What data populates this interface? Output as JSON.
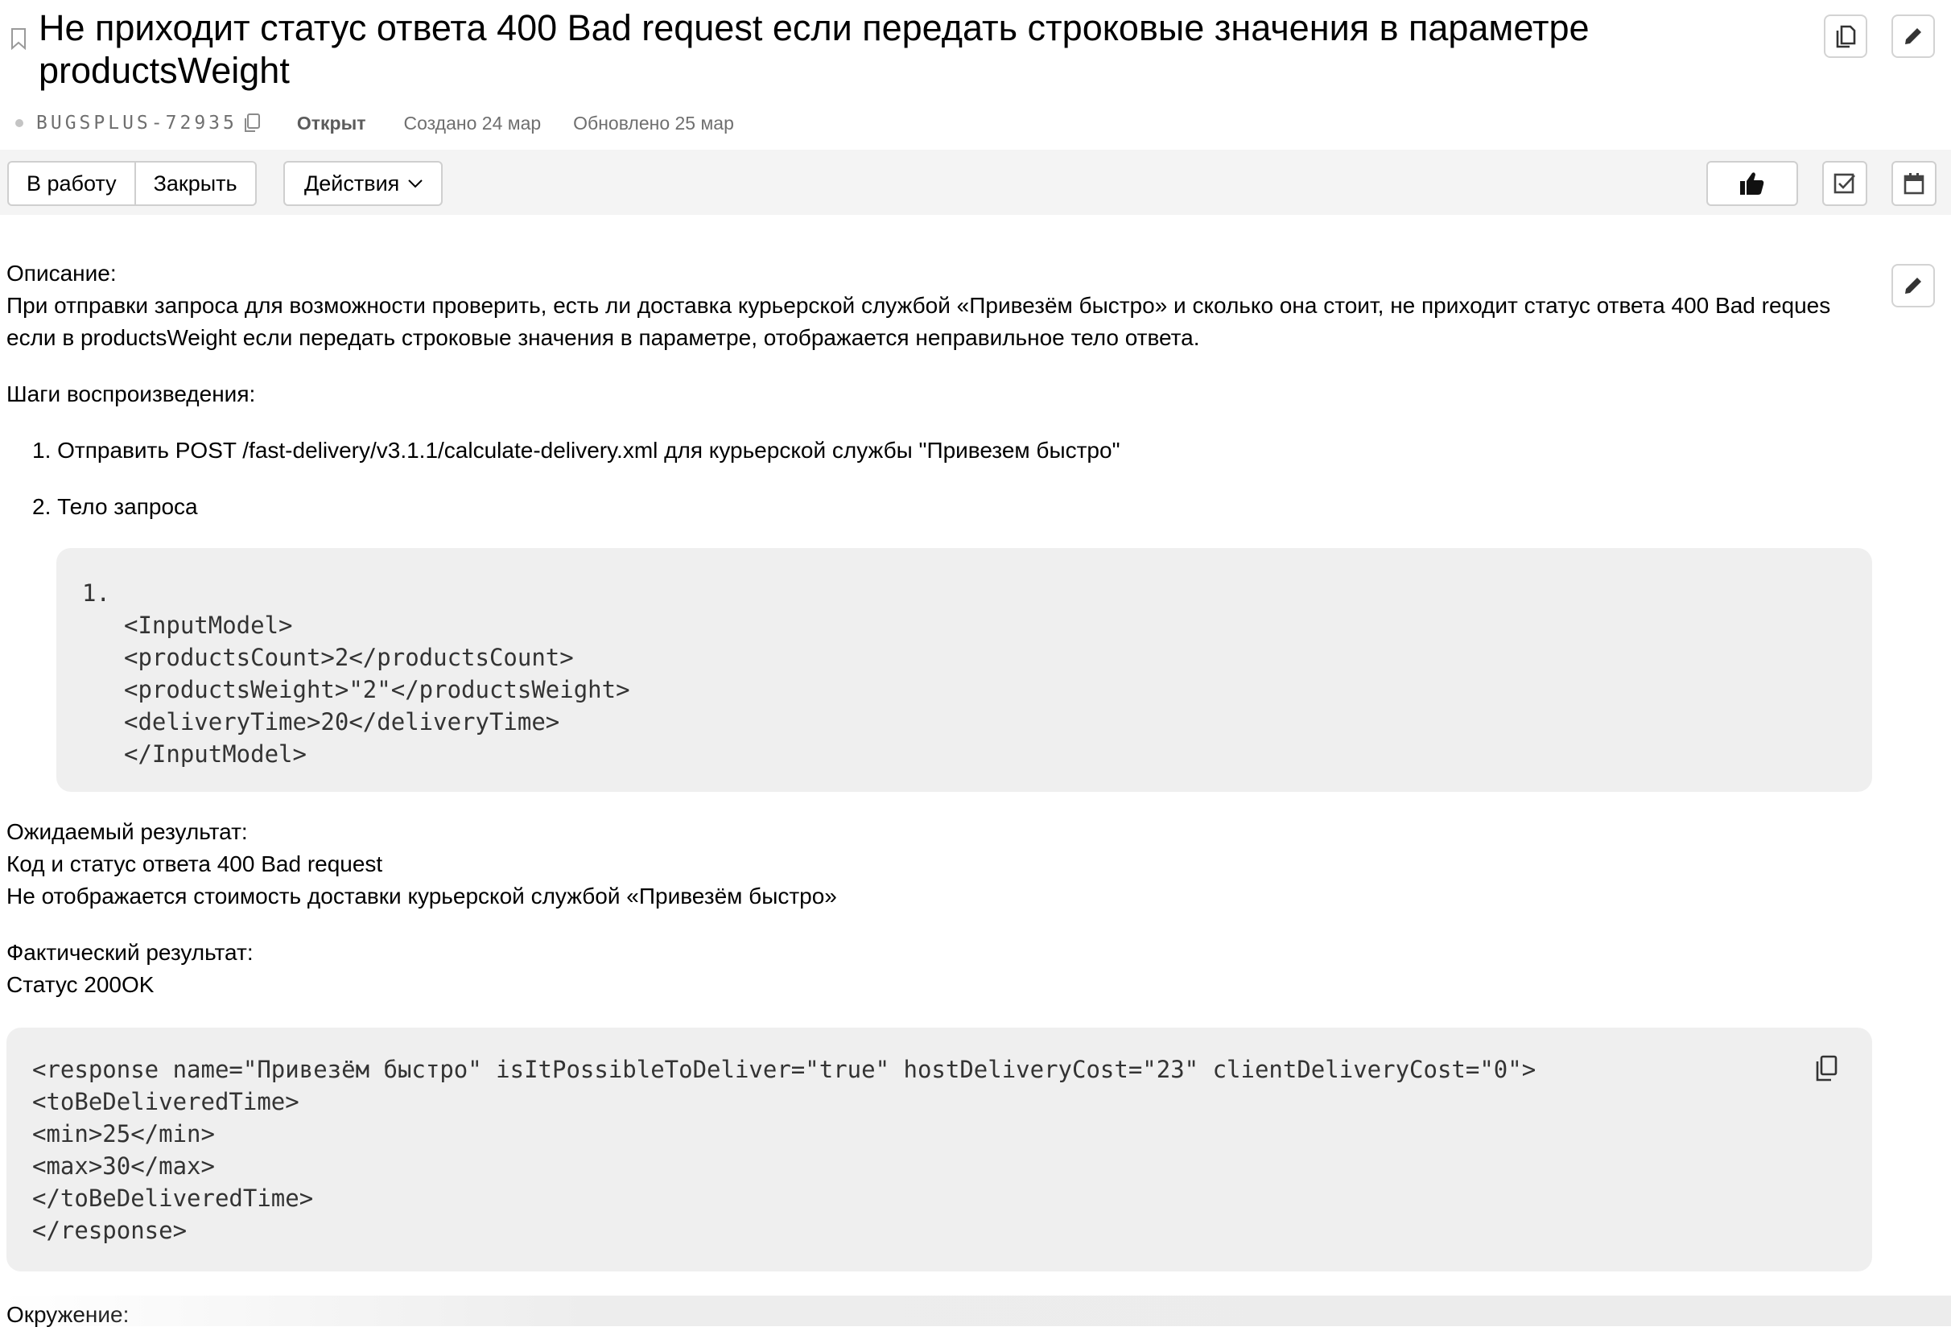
{
  "issue": {
    "title": "Не приходит статус ответа 400 Bad request если передать строковые значения в параметре productsWeight",
    "key": "BUGSPLUS-72935",
    "status": "Открыт",
    "created": "Создано 24 мар",
    "updated": "Обновлено 25 мар"
  },
  "toolbar": {
    "to_work": "В работу",
    "close": "Закрыть",
    "actions": "Действия"
  },
  "description": {
    "label": "Описание:",
    "line1": "При отправки запроса для возможности проверить, есть ли доставка курьерской службой «Привезём быстро» и сколько она стоит, не приходит статус ответа 400 Bad reques",
    "line2": "если в productsWeight если передать строковые значения в параметре, отображается неправильное тело ответа.",
    "steps_label": "Шаги воспроизведения:",
    "step1": "1. Отправить POST /fast-delivery/v3.1.1/calculate-delivery.xml для курьерской службы \"Привезем быстро\"",
    "step2": "2. Тело запроса",
    "request_code": {
      "num": "1.",
      "lines": [
        "<InputModel>",
        "<productsCount>2</productsCount>",
        "<productsWeight>\"2\"</productsWeight>",
        "<deliveryTime>20</deliveryTime>",
        "</InputModel>"
      ]
    },
    "expected_label": "Ожидаемый результат:",
    "expected1": "Код и статус ответа 400 Bad request",
    "expected2": "Не отображается стоимость доставки курьерской службой «Привезём быстро»",
    "actual_label": "Фактический результат:",
    "actual1": "Статус 200OK",
    "response_code": {
      "lines": [
        "<response name=\"Привезём быстро\" isItPossibleToDeliver=\"true\" hostDeliveryCost=\"23\" clientDeliveryCost=\"0\">",
        "<toBeDeliveredTime>",
        "<min>25</min>",
        "<max>30</max>",
        "</toBeDeliveredTime>",
        "</response>"
      ]
    },
    "env_label": "Окружение:"
  },
  "icons": {
    "bookmark": "bookmark-icon",
    "copy": "copy-icon",
    "clone": "clone-icon",
    "edit": "pencil-icon",
    "like": "thumbs-up-icon",
    "checklist": "checkbox-icon",
    "calendar": "calendar-icon",
    "chevron": "chevron-down-icon"
  }
}
